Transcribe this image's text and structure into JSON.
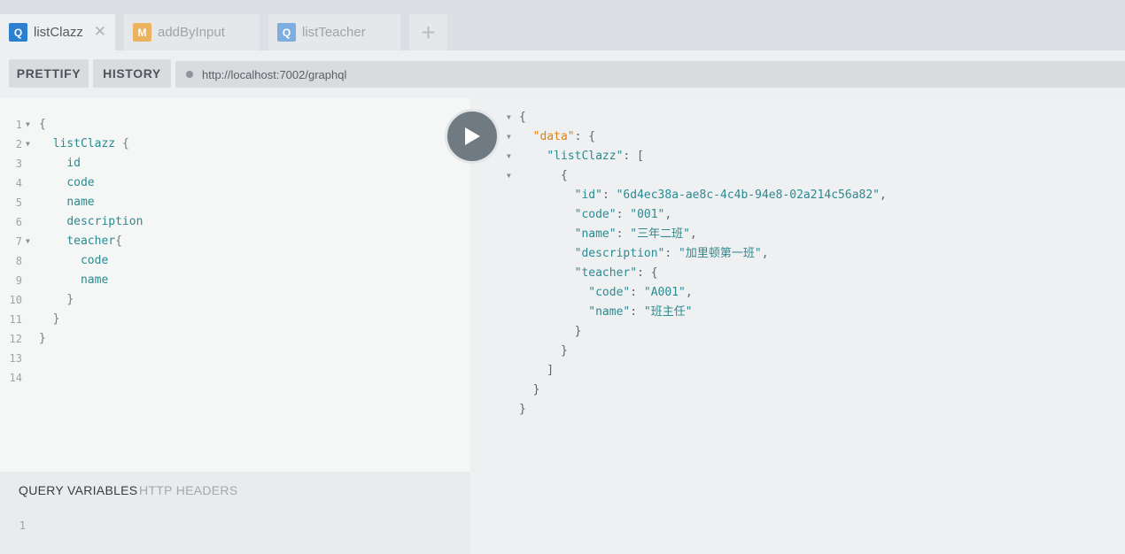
{
  "tabs": [
    {
      "badge": "Q",
      "label": "listClazz",
      "badge_color": "#2d7fd0",
      "active": true,
      "close": "✕"
    },
    {
      "badge": "M",
      "label": "addByInput",
      "badge_color": "#ebb25f",
      "active": false
    },
    {
      "badge": "Q",
      "label": "listTeacher",
      "badge_color": "#7eaee0",
      "active": false
    }
  ],
  "add_tab_label": "+",
  "toolbar": {
    "prettify_label": "PRETTIFY",
    "history_label": "HISTORY",
    "url": "http://localhost:7002/graphql"
  },
  "query_lines": [
    {
      "n": "1",
      "text": "{"
    },
    {
      "n": "2",
      "text": "  listClazz {"
    },
    {
      "n": "3",
      "text": "    id"
    },
    {
      "n": "4",
      "text": "    code"
    },
    {
      "n": "5",
      "text": "    name"
    },
    {
      "n": "6",
      "text": "    description"
    },
    {
      "n": "7",
      "text": "    teacher{"
    },
    {
      "n": "8",
      "text": "      code"
    },
    {
      "n": "9",
      "text": "      name"
    },
    {
      "n": "10",
      "text": "    }"
    },
    {
      "n": "11",
      "text": "  }"
    },
    {
      "n": "12",
      "text": "}"
    },
    {
      "n": "13",
      "text": ""
    },
    {
      "n": "14",
      "text": ""
    }
  ],
  "result_lines": [
    "{",
    "  \"data\": {",
    "    \"listClazz\": [",
    "      {",
    "        \"id\": \"6d4ec38a-ae8c-4c4b-94e8-02a214c56a82\",",
    "        \"code\": \"001\",",
    "        \"name\": \"三年二班\",",
    "        \"description\": \"加里顿第一班\",",
    "        \"teacher\": {",
    "          \"code\": \"A001\",",
    "          \"name\": \"班主任\"",
    "        }",
    "      }",
    "    ]",
    "  }",
    "}"
  ],
  "variables": {
    "tab_query_variables": "QUERY VARIABLES",
    "tab_http_headers": "HTTP HEADERS",
    "line_number": "1"
  }
}
